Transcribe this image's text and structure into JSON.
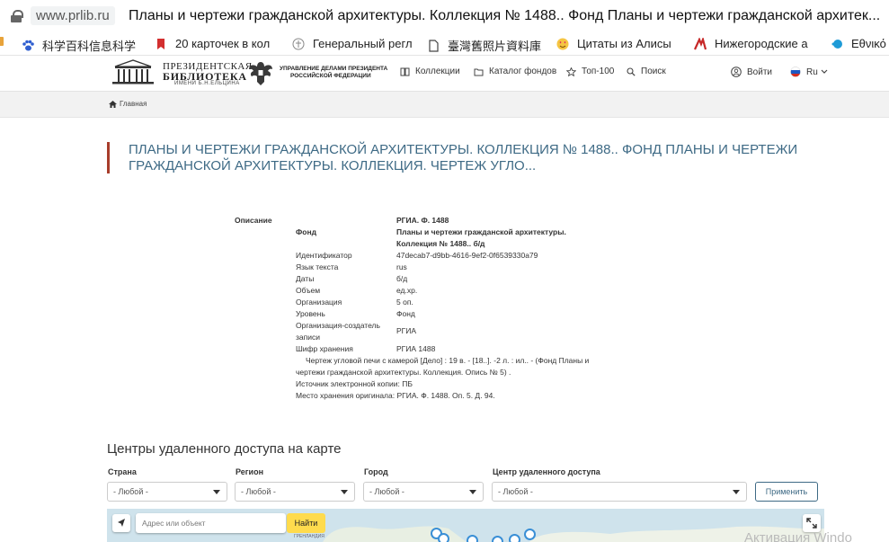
{
  "browser": {
    "url_domain": "www.prlib.ru",
    "tab_title": "Планы и чертежи гражданской архитектуры. Коллекция № 1488.. Фонд Планы и чертежи гражданской архитек..."
  },
  "bookmarks": [
    {
      "label": "科学百科信息科学",
      "icon": "paw-icon"
    },
    {
      "label": "20 карточек в кол",
      "icon": "bookmark-icon"
    },
    {
      "label": "Генеральный регл",
      "icon": "emblem-icon"
    },
    {
      "label": "臺灣舊照片資料庫",
      "icon": "page-icon"
    },
    {
      "label": "Цитаты из Алисы",
      "icon": "heart-eyes-icon"
    },
    {
      "label": "Нижегородские а",
      "icon": "nn-logo-icon"
    },
    {
      "label": "Εθνικό",
      "icon": "blue-dot-icon"
    }
  ],
  "header": {
    "logo_line1": "ПРЕЗИДЕНТСКАЯ",
    "logo_line2": "БИБЛИОТЕКА",
    "logo_line3": "ИМЕНИ Б.Н.ЕЛЬЦИНА",
    "udp_line1": "УПРАВЛЕНИЕ ДЕЛАМИ ПРЕЗИДЕНТА",
    "udp_line2": "РОССИЙСКОЙ ФЕДЕРАЦИИ",
    "nav": {
      "collections": "Коллекции",
      "catalog": "Каталог фондов",
      "top100": "Топ-100",
      "search": "Поиск",
      "login": "Войти",
      "lang": "Ru"
    }
  },
  "breadcrumb": {
    "home": "Главная"
  },
  "page": {
    "title": "ПЛАНЫ И ЧЕРТЕЖИ ГРАЖДАНСКОЙ АРХИТЕКТУРЫ. КОЛЛЕКЦИЯ № 1488.. ФОНД ПЛАНЫ И ЧЕРТЕЖИ ГРАЖДАНСКОЙ АРХИТЕКТУРЫ. КОЛЛЕКЦИЯ. ЧЕРТЕЖ УГЛО..."
  },
  "description": {
    "section_label": "Описание",
    "archive": "РГИА. Ф. 1488",
    "fund_label": "Фонд",
    "fund_value_line1": "Планы и чертежи гражданской архитектуры.",
    "fund_value_line2": "Коллекция № 1488.. б/д",
    "rows": [
      {
        "label": "Идентификатор",
        "value": "47decab7-d9bb-4616-9ef2-0f6539330a79"
      },
      {
        "label": "Язык текста",
        "value": "rus"
      },
      {
        "label": "Даты",
        "value": "б/д"
      },
      {
        "label": "Объем",
        "value": "ед.хр."
      },
      {
        "label": "Организация",
        "value": "5 оп."
      },
      {
        "label": "Уровень",
        "value": "Фонд"
      }
    ],
    "creator_label_line1": "Организация-создатель",
    "creator_label_line2": "записи",
    "creator_value": "РГИА",
    "storage_label": "Шифр хранения",
    "storage_value": "РГИА 1488",
    "note_line1": "Чертеж угловой печи с камерой [Дело] : 19 в. - [18..]. -2 л. : ил.. - (Фонд Планы и",
    "note_line2": "чертежи гражданской архитектуры. Коллекция. Опись № 5) .",
    "source": "Источник электронной копии: ПБ",
    "location": "Место хранения оригинала: РГИА. Ф. 1488. Оп. 5. Д. 94."
  },
  "map_section": {
    "heading": "Центры удаленного доступа на карте",
    "filters": {
      "country_label": "Страна",
      "region_label": "Регион",
      "city_label": "Город",
      "center_label": "Центр удаленного доступа",
      "any": "- Любой -",
      "apply": "Применить"
    },
    "map": {
      "search_placeholder": "Адрес или объект",
      "find": "Найти",
      "geo_label": "ГРЕНЛАНДИЯ"
    }
  },
  "watermark": "Активация Windo",
  "colors": {
    "title": "#3e6a85",
    "title_accent": "#a83d2b",
    "map_water": "#cfe3ec",
    "find_button": "#ffdb4d"
  }
}
